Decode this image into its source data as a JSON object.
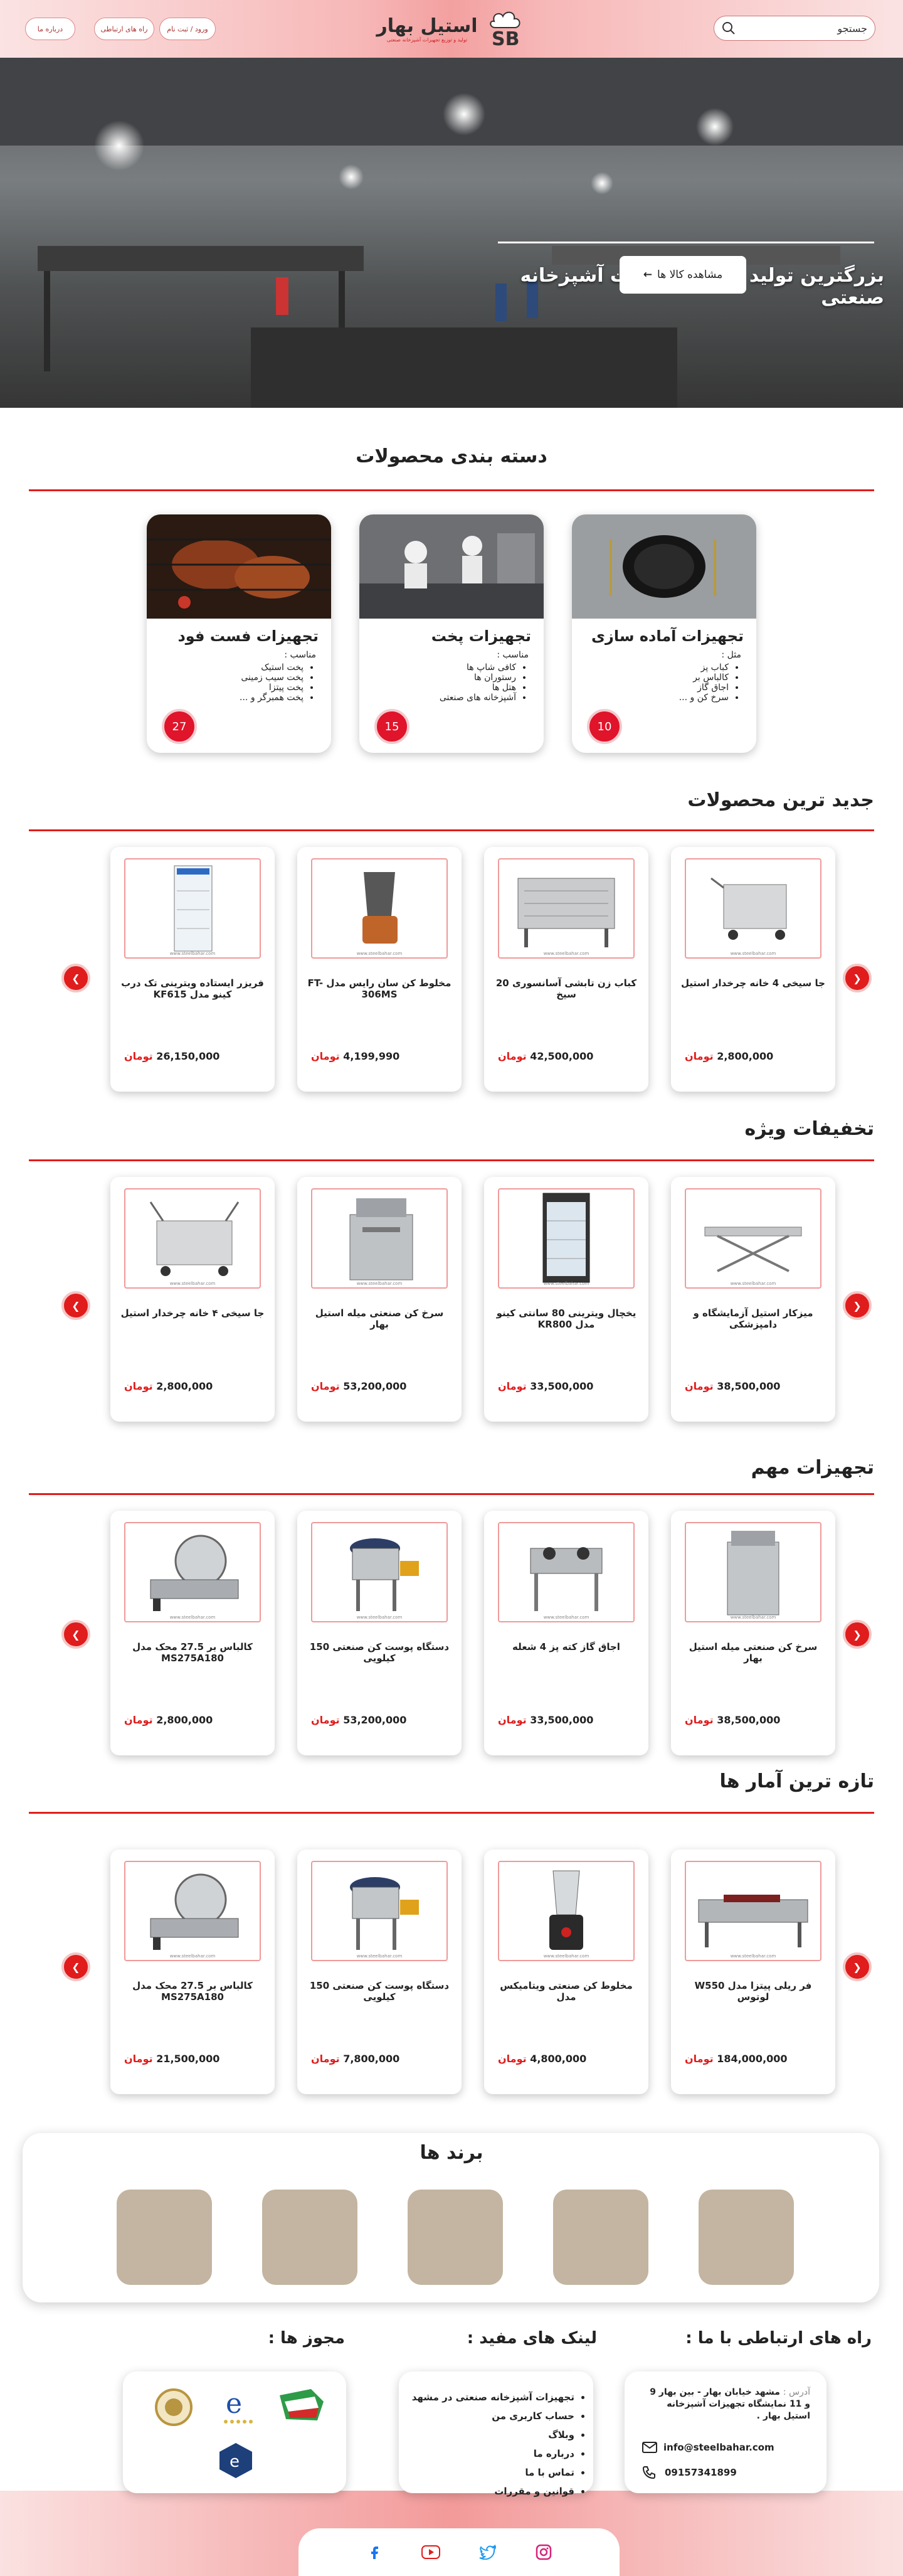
{
  "header": {
    "buttons": [
      "درباره ما",
      "راه های ارتباطی",
      "ورود / ثبت نام"
    ],
    "search_placeholder": "جستجو",
    "logo_name": "استیل بهار",
    "logo_tagline": "تولید و توزیع تجهیزات آشپزخانه صنعتی"
  },
  "hero": {
    "title": "بزرگترین تولید کننده تجهیزات آشپزخانه صنعتی",
    "button": "مشاهده کالا ها"
  },
  "categories": {
    "title": "دسته بندی محصولات",
    "items": [
      {
        "title": "تجهیزات آماده سازی",
        "subtitle": "مثل :",
        "list": [
          "کباب پز",
          "کالباس بر",
          "اجاق گاز",
          "سرخ کن و ..."
        ],
        "count": "10"
      },
      {
        "title": "تجهیزات پخت",
        "subtitle": "مناسب :",
        "list": [
          "کافی شاپ ها",
          "رستوران ها",
          "هتل ها",
          "آشپزخانه های صنعتی"
        ],
        "count": "15"
      },
      {
        "title": "تجهیزات فست فود",
        "subtitle": "مناسب :",
        "list": [
          "پخت استیک",
          "پخت سیب زمینی",
          "پخت پیتزا",
          "پخت همبرگر و ..."
        ],
        "count": "27"
      }
    ]
  },
  "currency": "تومان",
  "image_watermark": "www.steelbahar.com",
  "sections": [
    {
      "title": "جدید ترین محصولات",
      "products": [
        {
          "name": "جا سیخی 4 خانه چرخدار استیل",
          "price": "2,800,000"
        },
        {
          "name": "کباب زن تابشی آسانسوری 20 سیخ",
          "price": "42,500,000"
        },
        {
          "name": "مخلوط کن سان رایس مدل FT-306MS",
          "price": "4,199,990"
        },
        {
          "name": "فریزر ایستاده ویترینی تک درب کینو مدل KF615",
          "price": "26,150,000"
        }
      ]
    },
    {
      "title": "تخفیفات ویژه",
      "products": [
        {
          "name": "میزکار استیل آزمایشگاه و دامپزشکی",
          "price": "38,500,000"
        },
        {
          "name": "یخچال ویترینی 80 سانتی کینو مدل KR800",
          "price": "33,500,000"
        },
        {
          "name": "سرخ کن صنعتی میله استیل بهار",
          "price": "53,200,000"
        },
        {
          "name": "جا سیخی ۴ خانه چرخدار استیل",
          "price": "2,800,000"
        }
      ]
    },
    {
      "title": "تجهیزات مهم",
      "products": [
        {
          "name": "سرخ کن صنعتی میله استیل بهار",
          "price": "38,500,000"
        },
        {
          "name": "اجاق گاز کته پز 4 شعله",
          "price": "33,500,000"
        },
        {
          "name": "دستگاه پوست کن صنعتی 150 کیلویی",
          "price": "53,200,000"
        },
        {
          "name": "کالباس بر 27.5 محک مدل MS275A180",
          "price": "2,800,000"
        }
      ]
    },
    {
      "title": "تازه ترین آمار ها",
      "products": [
        {
          "name": "فر ریلی پیتزا مدل W550 لوتوس",
          "price": "184,000,000"
        },
        {
          "name": "مخلوط کن صنعتی ویتامیکس مدل",
          "price": "4,800,000"
        },
        {
          "name": "دستگاه پوست کن صنعتی 150 کیلویی",
          "price": "7,800,000"
        },
        {
          "name": "کالباس بر 27.5 محک مدل MS275A180",
          "price": "21,500,000"
        }
      ]
    }
  ],
  "brands": {
    "title": "برند ها"
  },
  "footer": {
    "contact_title": "راه های ارتباطی با ما :",
    "links_title": "لینک های مفید :",
    "licenses_title": "مجوز ها :",
    "address_label": "آدرس :",
    "address": "مشهد خیابان بهار - بین بهار 9 و 11 نمایشگاه تجهیزات آشپزخانه استیل بهار .",
    "email": "info@steelbahar.com",
    "phone": "09157341899",
    "links": [
      "تجهیزات آشپزخانه صنعتی در مشهد",
      "حساب کاربری من",
      "وبلاگ",
      "درباره ما",
      "تماس با ما",
      "قوانین و مقررات"
    ]
  },
  "colors": {
    "accent": "#e01c1c",
    "header_pink": "#f3a0a0",
    "brand_tile": "#c3b5a1"
  }
}
